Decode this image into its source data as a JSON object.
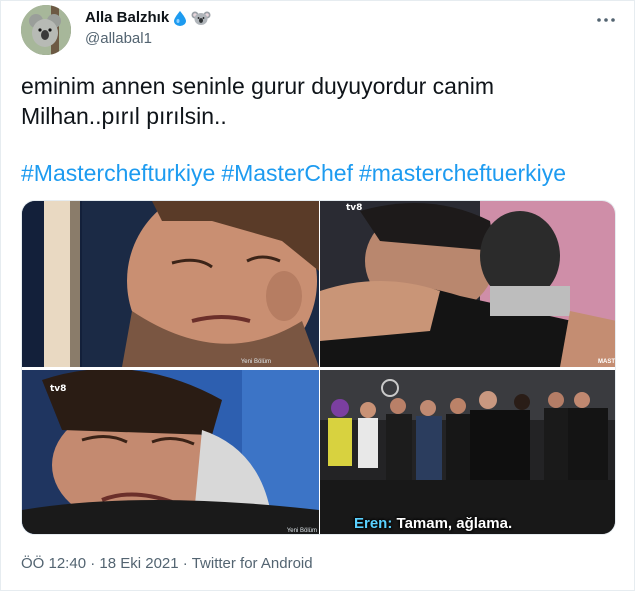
{
  "author": {
    "display_name": "Alla Balzhık",
    "handle": "@allabal1",
    "badges": [
      "water-drop-icon",
      "koala-icon"
    ]
  },
  "tweet": {
    "line1": "eminim annen seninle gurur duyuyordur canim",
    "line2": "Milhan..pırıl pırılsin..",
    "hashtags": [
      "#Masterchefturkiye",
      "#MasterChef",
      "#mastercheftuerkiye"
    ]
  },
  "media": {
    "watermarks": {
      "channel": "tv8",
      "corner": "MAST",
      "small_label": "Yeni Bölüm"
    },
    "subtitle": {
      "speaker": "Eren:",
      "text": "Tamam, ağlama."
    }
  },
  "footer": {
    "time": "ÖÖ 12:40",
    "date": "18 Eki 2021",
    "source": "Twitter for Android",
    "separator": "·"
  },
  "colors": {
    "link": "#1d9bf0",
    "secondary_text": "#536471",
    "verified_drop": "#1d9bf0"
  }
}
